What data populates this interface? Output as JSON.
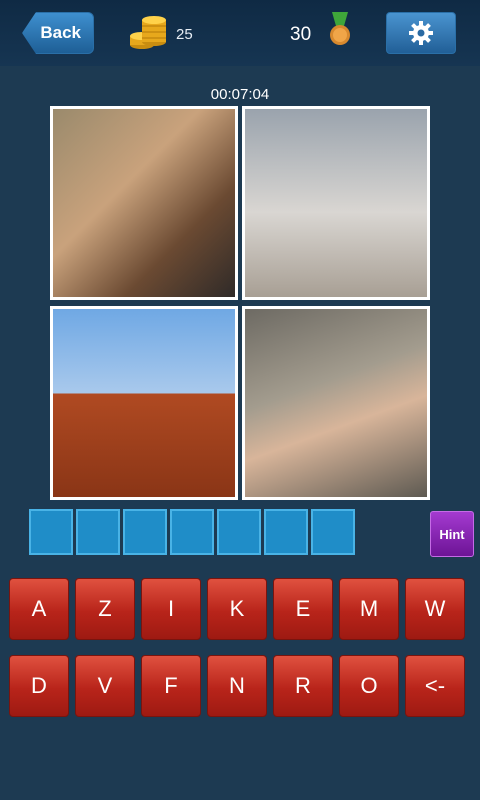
{
  "header": {
    "back_label": "Back",
    "coins": "25",
    "score": "30",
    "settings_icon": "gear-icon"
  },
  "timer": "00:07:04",
  "photos": [
    "photo-1",
    "photo-2",
    "photo-3",
    "photo-4"
  ],
  "answer_slots": 7,
  "hint_label": "Hint",
  "keyboard": {
    "row1": [
      "A",
      "Z",
      "I",
      "K",
      "E",
      "M",
      "W"
    ],
    "row2": [
      "D",
      "V",
      "F",
      "N",
      "R",
      "O",
      "<-"
    ]
  },
  "colors": {
    "background": "#1d3a52",
    "slot": "#1f8dc8",
    "key": "#c62d22",
    "hint": "#8a26b8"
  }
}
